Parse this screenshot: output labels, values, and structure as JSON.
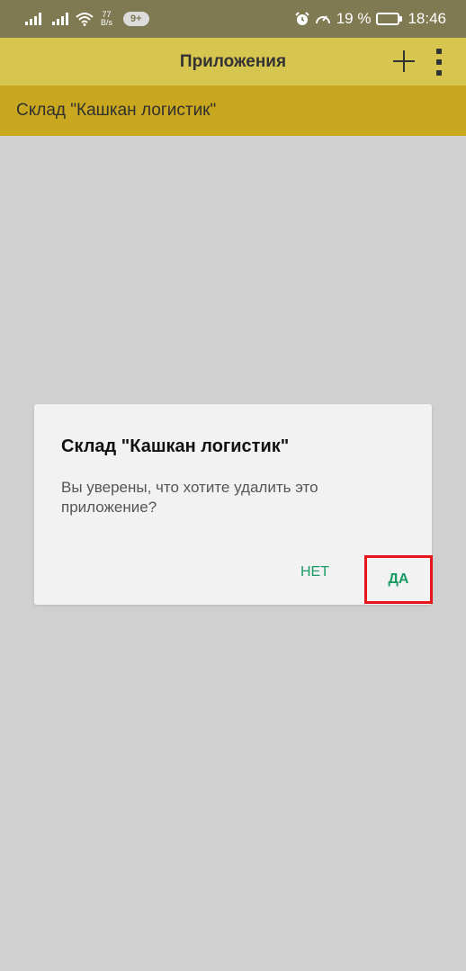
{
  "status_bar": {
    "net_speed_value": "77",
    "net_speed_unit": "B/s",
    "notification_badge": "9+",
    "battery_percent": "19 %",
    "battery_level": 0.19,
    "time": "18:46"
  },
  "app_bar": {
    "title": "Приложения"
  },
  "list": {
    "selected_item": "Склад \"Кашкан логистик\""
  },
  "dialog": {
    "title": "Склад \"Кашкан логистик\"",
    "message": "Вы уверены, что хотите удалить это приложение?",
    "no_label": "НЕТ",
    "yes_label": "ДА"
  },
  "colors": {
    "status_bar": "#7f7a52",
    "app_bar": "#d6c54e",
    "selected_row": "#c9a71e",
    "background": "#d0d0d0",
    "dialog": "#f2f2f2",
    "accent_button": "#1a9a63",
    "highlight_frame": "#e8141c"
  }
}
